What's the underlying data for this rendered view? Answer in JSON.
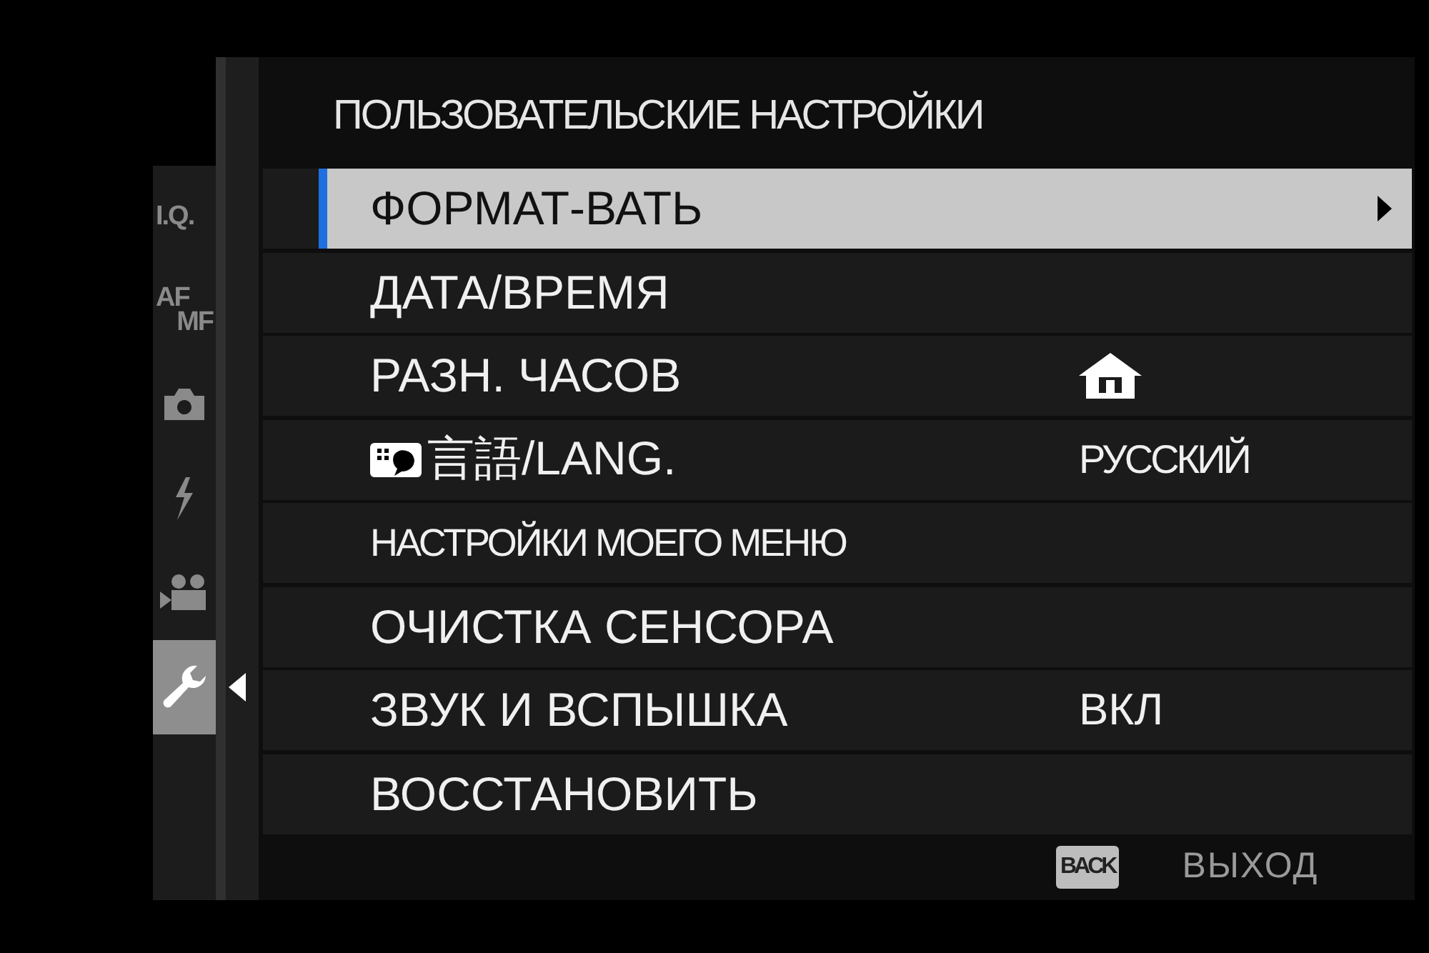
{
  "tabs": [
    {
      "kind": "text",
      "lines": [
        "I.Q."
      ],
      "selected": false
    },
    {
      "kind": "text",
      "lines": [
        "AF",
        "MF"
      ],
      "selected": false
    },
    {
      "kind": "camera",
      "selected": false
    },
    {
      "kind": "flash",
      "selected": false
    },
    {
      "kind": "movie",
      "selected": false
    },
    {
      "kind": "wrench",
      "selected": true
    }
  ],
  "menu": {
    "title": "ПОЛЬЗОВАТЕЛЬСКИЕ НАСТРОЙКИ",
    "items": [
      {
        "kind": "plain",
        "label": "ФОРМАТ-ВАТЬ",
        "selected": true,
        "submenu": true
      },
      {
        "kind": "plain",
        "label": "ДАТА/ВРЕМЯ",
        "selected": false
      },
      {
        "kind": "home",
        "label": "РАЗН. ЧАСОВ",
        "selected": false
      },
      {
        "kind": "language",
        "label": "言語/LANG.",
        "selected": false,
        "value": "РУССКИЙ",
        "value_narrow": true
      },
      {
        "kind": "plain",
        "label": "НАСТРОЙКИ МОЕГО МЕНЮ",
        "selected": false,
        "narrow": true
      },
      {
        "kind": "plain",
        "label": "ОЧИСТКА СЕНСОРА",
        "selected": false
      },
      {
        "kind": "plain",
        "label": "ЗВУК И ВСПЫШКА",
        "selected": false,
        "value": "ВКЛ"
      },
      {
        "kind": "plain",
        "label": "ВОССТАНОВИТЬ",
        "selected": false
      }
    ]
  },
  "footer": {
    "key": "BACK",
    "action": "ВЫХОД"
  }
}
